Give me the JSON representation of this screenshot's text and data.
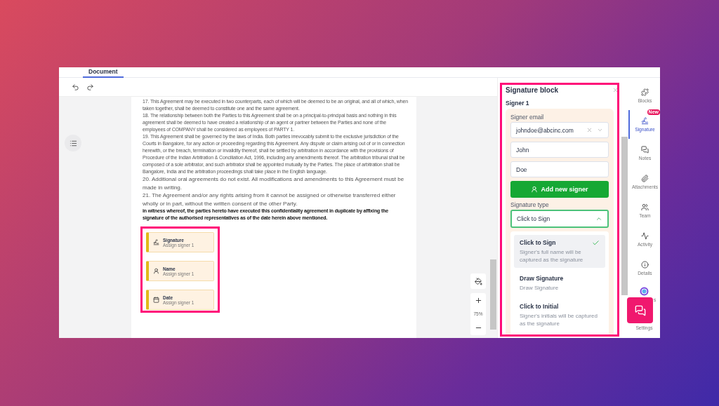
{
  "tabs": [
    {
      "label": "Document",
      "selected": true
    }
  ],
  "document": {
    "paragraphs": [
      {
        "kind": "small",
        "text": "17. This Agreement may be executed in two counterparts, each of which will be deemed to be an original, and all of which, when taken together, shall be deemed to constitute one and the same agreement."
      },
      {
        "kind": "small",
        "text": "18. The relationship between both the Parties to this Agreement shall be on a principal-to-principal basis and nothing in this agreement shall be deemed to have created a relationship of an agent or partner between the Parties and none of the employees of COMPANY shall be considered as employees of PARTY 1."
      },
      {
        "kind": "small",
        "text": "19. This Agreement shall be governed by the laws of India. Both parties irrevocably submit to the exclusive jurisdiction of the Courts in Bangalore, for any action or proceeding regarding this Agreement. Any dispute or claim arising out of or in connection herewith, or the breach, termination or invalidity thereof, shall be settled by arbitration in accordance with the provisions of Procedure of the Indian Arbitration & Conciliation Act, 1996, including any amendments thereof. The arbitration tribunal shall be composed of a sole arbitrator, and such arbitrator shall be appointed mutually by the Parties. The place of arbitration shall be Bangalore, India and the arbitration proceedings shall take place in the English language."
      },
      {
        "kind": "large",
        "text": "20. Additional oral agreements do not exist. All modifications and amendments to this Agreement must be made in writing."
      },
      {
        "kind": "large",
        "text": "21. The Agreement and/or any rights arising from it cannot be assigned or otherwise transferred either wholly or in part, without the written consent of the other Party."
      },
      {
        "kind": "bold",
        "text": "in witness whereof, the parties hereto have executed this confidentiality agreement in duplicate by affixing the signature of the authorised representatives as of the date herein above mentioned."
      }
    ],
    "fields": [
      {
        "kind": "signature",
        "label": "Signature",
        "hint": "Assign signer 1"
      },
      {
        "kind": "name",
        "label": "Name",
        "hint": "Assign signer 1"
      },
      {
        "kind": "date",
        "label": "Date",
        "hint": "Assign signer 1"
      }
    ]
  },
  "zoom": {
    "reading": "75%"
  },
  "panel": {
    "title": "Signature block",
    "signer_heading": "Signer 1",
    "email_label": "Signer email",
    "email_value": "johndoe@abcinc.com",
    "first_name": "John",
    "last_name": "Doe",
    "add_button": "Add new signer",
    "type_label": "Signature type",
    "type_value": "Click to Sign",
    "type_expanded": true,
    "options": [
      {
        "title": "Click to Sign",
        "description": "Signer's full name will be captured as the signature",
        "selected": true
      },
      {
        "title": "Draw Signature",
        "description": "Draw Signature",
        "selected": false
      },
      {
        "title": "Click to Initial",
        "description": "Signer's initials will be captured as the signature",
        "selected": false
      }
    ]
  },
  "rail": [
    {
      "kind": "blocks",
      "label": "Blocks",
      "selected": false
    },
    {
      "kind": "signature",
      "label": "Signature",
      "selected": true,
      "badge": "New"
    },
    {
      "kind": "notes",
      "label": "Notes",
      "selected": false
    },
    {
      "kind": "attachments",
      "label": "Attachments",
      "selected": false
    },
    {
      "kind": "team",
      "label": "Team",
      "selected": false
    },
    {
      "kind": "activity",
      "label": "Activity",
      "selected": false
    },
    {
      "kind": "details",
      "label": "Details",
      "selected": false
    },
    {
      "kind": "covered",
      "label": "s",
      "selected": false
    },
    {
      "kind": "settings",
      "label": "Settings",
      "selected": false
    }
  ]
}
